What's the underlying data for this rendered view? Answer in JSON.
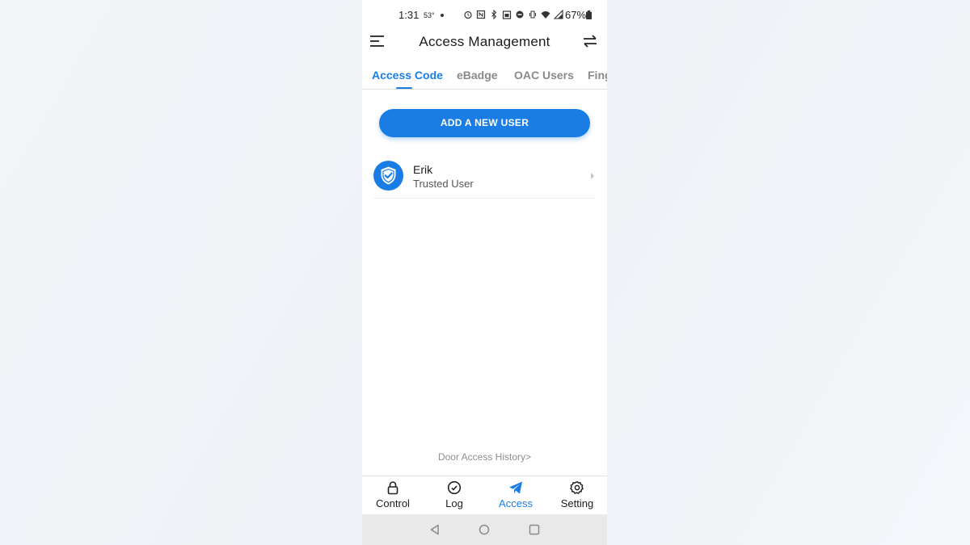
{
  "status_bar": {
    "time": "1:31",
    "temperature": "53°",
    "battery": "67%"
  },
  "header": {
    "title": "Access Management"
  },
  "tabs": [
    {
      "label": "Access Code",
      "active": true
    },
    {
      "label": "eBadge",
      "active": false
    },
    {
      "label": "OAC Users",
      "active": false
    },
    {
      "label": "Fing",
      "active": false
    }
  ],
  "add_user_label": "ADD A NEW USER",
  "users": [
    {
      "name": "Erik",
      "role": "Trusted User"
    }
  ],
  "history_link": "Door Access History>",
  "bottom_nav": [
    {
      "label": "Control",
      "icon": "lock-icon",
      "active": false
    },
    {
      "label": "Log",
      "icon": "clock-icon",
      "active": false
    },
    {
      "label": "Access",
      "icon": "send-icon",
      "active": true
    },
    {
      "label": "Setting",
      "icon": "gear-icon",
      "active": false
    }
  ],
  "colors": {
    "accent": "#1a7de6",
    "text": "#1c1c1c",
    "muted": "#8a8a8a"
  }
}
